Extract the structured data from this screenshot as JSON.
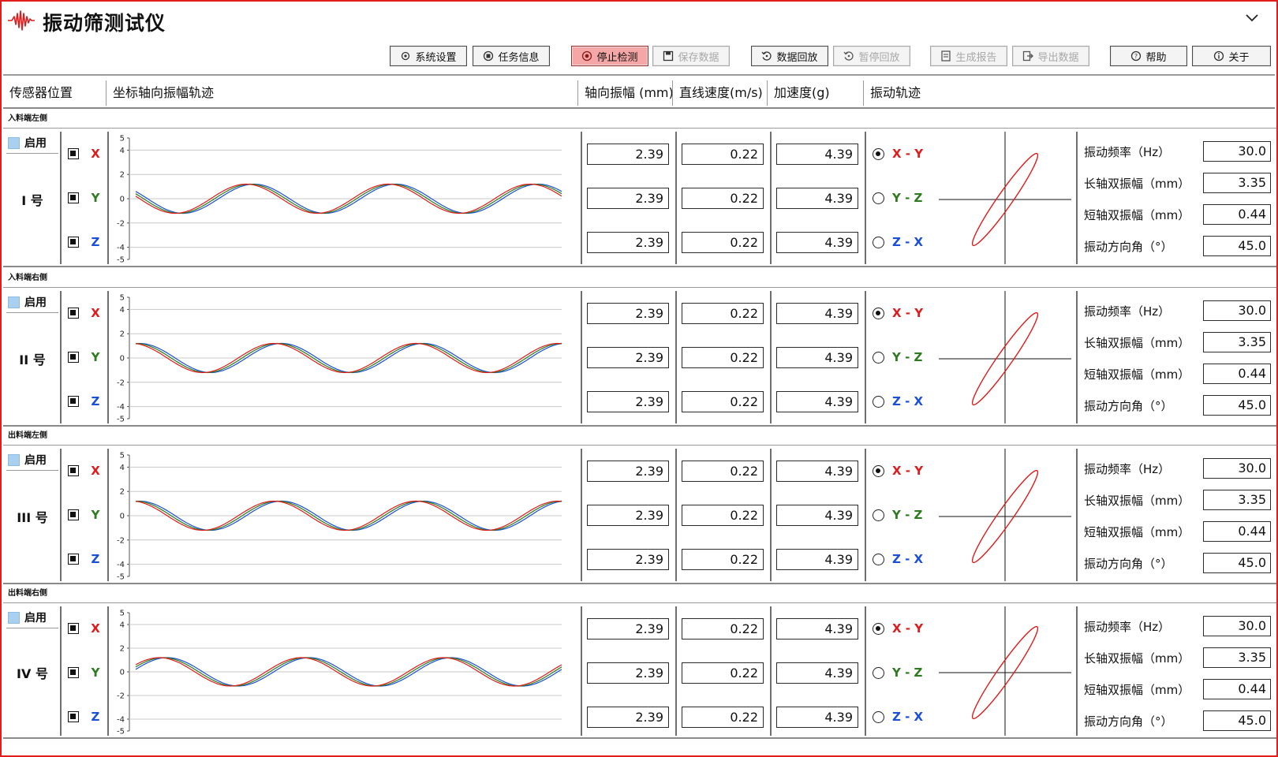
{
  "app": {
    "title": "振动筛测试仪"
  },
  "colors": {
    "x_axis": "#e01b1b",
    "y_axis": "#2d7a1f",
    "z_axis": "#1a4fd6",
    "border": "#e11d1d",
    "active_button": "#f5a6a6",
    "enable_box": "#a9d1ef"
  },
  "toolbar": {
    "buttons": [
      {
        "label": "系统设置",
        "icon": "gear-icon",
        "state": "normal"
      },
      {
        "label": "任务信息",
        "icon": "task-icon",
        "state": "normal"
      },
      {
        "label": "停止检测",
        "icon": "stop-icon",
        "state": "active"
      },
      {
        "label": "保存数据",
        "icon": "save-icon",
        "state": "disabled"
      },
      {
        "label": "数据回放",
        "icon": "replay-icon",
        "state": "normal"
      },
      {
        "label": "暂停回放",
        "icon": "pause-replay-icon",
        "state": "disabled"
      },
      {
        "label": "生成报告",
        "icon": "report-icon",
        "state": "disabled"
      },
      {
        "label": "导出数据",
        "icon": "export-icon",
        "state": "disabled"
      },
      {
        "label": "帮助",
        "icon": "help-icon",
        "state": "normal"
      },
      {
        "label": "关于",
        "icon": "info-icon",
        "state": "normal"
      }
    ]
  },
  "headers": {
    "sensor_position": "传感器位置",
    "trajectory": "坐标轴向振幅轨迹",
    "amplitude": "轴向振幅 (mm)",
    "velocity": "直线速度(m/s)",
    "acceleration": "加速度(g)",
    "vibration_trajectory": "振动轨迹"
  },
  "axes": {
    "x": "X",
    "y": "Y",
    "z": "Z"
  },
  "planes": {
    "xy": "X - Y",
    "yz": "Y - Z",
    "zx": "Z - X"
  },
  "enable_label": "启用",
  "stat_labels": {
    "frequency": "振动频率（Hz）",
    "long_axis": "长轴双振幅（mm）",
    "short_axis": "短轴双振幅（mm）",
    "direction": "振动方向角（°）"
  },
  "sensors": [
    {
      "position": "入料端左侧",
      "name": "I 号",
      "amplitude": [
        "2.39",
        "2.39",
        "2.39"
      ],
      "velocity": [
        "0.22",
        "0.22",
        "0.22"
      ],
      "acceleration": [
        "4.39",
        "4.39",
        "4.39"
      ],
      "frequency": "30.0",
      "long_axis": "3.35",
      "short_axis": "0.44",
      "direction": "45.0"
    },
    {
      "position": "入料端右侧",
      "name": "II 号",
      "amplitude": [
        "2.39",
        "2.39",
        "2.39"
      ],
      "velocity": [
        "0.22",
        "0.22",
        "0.22"
      ],
      "acceleration": [
        "4.39",
        "4.39",
        "4.39"
      ],
      "frequency": "30.0",
      "long_axis": "3.35",
      "short_axis": "0.44",
      "direction": "45.0"
    },
    {
      "position": "出料端左侧",
      "name": "III 号",
      "amplitude": [
        "2.39",
        "2.39",
        "2.39"
      ],
      "velocity": [
        "0.22",
        "0.22",
        "0.22"
      ],
      "acceleration": [
        "4.39",
        "4.39",
        "4.39"
      ],
      "frequency": "30.0",
      "long_axis": "3.35",
      "short_axis": "0.44",
      "direction": "45.0"
    },
    {
      "position": "出料端右侧",
      "name": "IV 号",
      "amplitude": [
        "2.39",
        "2.39",
        "2.39"
      ],
      "velocity": [
        "0.22",
        "0.22",
        "0.22"
      ],
      "acceleration": [
        "4.39",
        "4.39",
        "4.39"
      ],
      "frequency": "30.0",
      "long_axis": "3.35",
      "short_axis": "0.44",
      "direction": "45.0"
    }
  ],
  "chart_data": {
    "type": "line",
    "ylim": [
      -5,
      5
    ],
    "yticks": [
      "5",
      "4",
      "2",
      "0",
      "-2",
      "-4",
      "-5"
    ],
    "waves": [
      {
        "sensor": "I 号",
        "series": [
          {
            "name": "X",
            "amplitude": 1.2,
            "cycles": 3,
            "phase_deg": 170
          },
          {
            "name": "Y",
            "amplitude": 1.2,
            "cycles": 3,
            "phase_deg": 160
          },
          {
            "name": "Z",
            "amplitude": 1.2,
            "cycles": 3,
            "phase_deg": 150
          }
        ]
      },
      {
        "sensor": "II 号",
        "series": [
          {
            "name": "X",
            "amplitude": 1.2,
            "cycles": 3,
            "phase_deg": 100
          },
          {
            "name": "Y",
            "amplitude": 1.2,
            "cycles": 3,
            "phase_deg": 90
          },
          {
            "name": "Z",
            "amplitude": 1.2,
            "cycles": 3,
            "phase_deg": 80
          }
        ]
      },
      {
        "sensor": "III 号",
        "series": [
          {
            "name": "X",
            "amplitude": 1.2,
            "cycles": 3,
            "phase_deg": 100
          },
          {
            "name": "Y",
            "amplitude": 1.2,
            "cycles": 3,
            "phase_deg": 90
          },
          {
            "name": "Z",
            "amplitude": 1.2,
            "cycles": 3,
            "phase_deg": 80
          }
        ]
      },
      {
        "sensor": "IV 号",
        "series": [
          {
            "name": "X",
            "amplitude": 1.2,
            "cycles": 3,
            "phase_deg": 30
          },
          {
            "name": "Y",
            "amplitude": 1.2,
            "cycles": 3,
            "phase_deg": 20
          },
          {
            "name": "Z",
            "amplitude": 1.2,
            "cycles": 3,
            "phase_deg": 10
          }
        ]
      }
    ]
  }
}
